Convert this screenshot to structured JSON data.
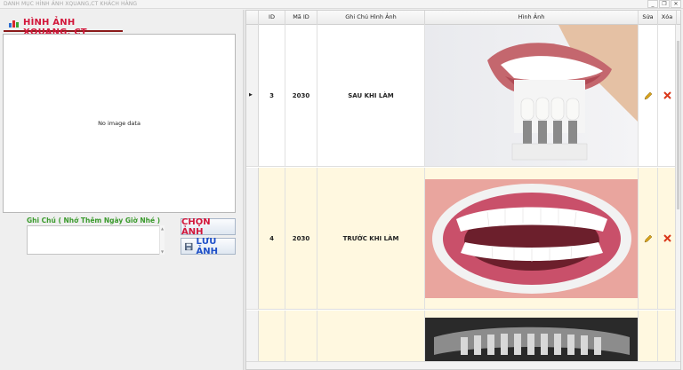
{
  "window": {
    "title": "DANH MỤC HÌNH ẢNH XQUANG,CT KHÁCH HÀNG",
    "minimize": "_",
    "restore": "❐",
    "close": "✕"
  },
  "left_panel": {
    "tab_title": "HÌNH ẢNH XQUANG, CT",
    "no_image": "No image data",
    "note_label": "Ghi Chú ( Nhớ Thêm Ngày Giờ Nhé )",
    "note_value": "",
    "choose_button": "CHỌN ẢNH",
    "save_button": "LƯU ẢNH"
  },
  "grid": {
    "columns": [
      "ID",
      "Mã ID",
      "Ghi Chú Hình Ảnh",
      "Hình Ảnh",
      "Sửa",
      "Xóa"
    ],
    "rows": [
      {
        "id": "3",
        "ma_id": "2030",
        "note": "SAU KHI LÀM",
        "image": "teeth-shade-guide-photo",
        "selected": true
      },
      {
        "id": "4",
        "ma_id": "2030",
        "note": "TRƯỚC KHI LÀM",
        "image": "open-mouth-retractor-photo",
        "selected": false
      },
      {
        "id": "",
        "ma_id": "",
        "note": "",
        "image": "panoramic-xray-photo",
        "selected": false
      }
    ],
    "colors": {
      "alt_row": "#fff8e0",
      "edit_icon": "#d7a21c",
      "delete_icon": "#d9371a"
    }
  }
}
